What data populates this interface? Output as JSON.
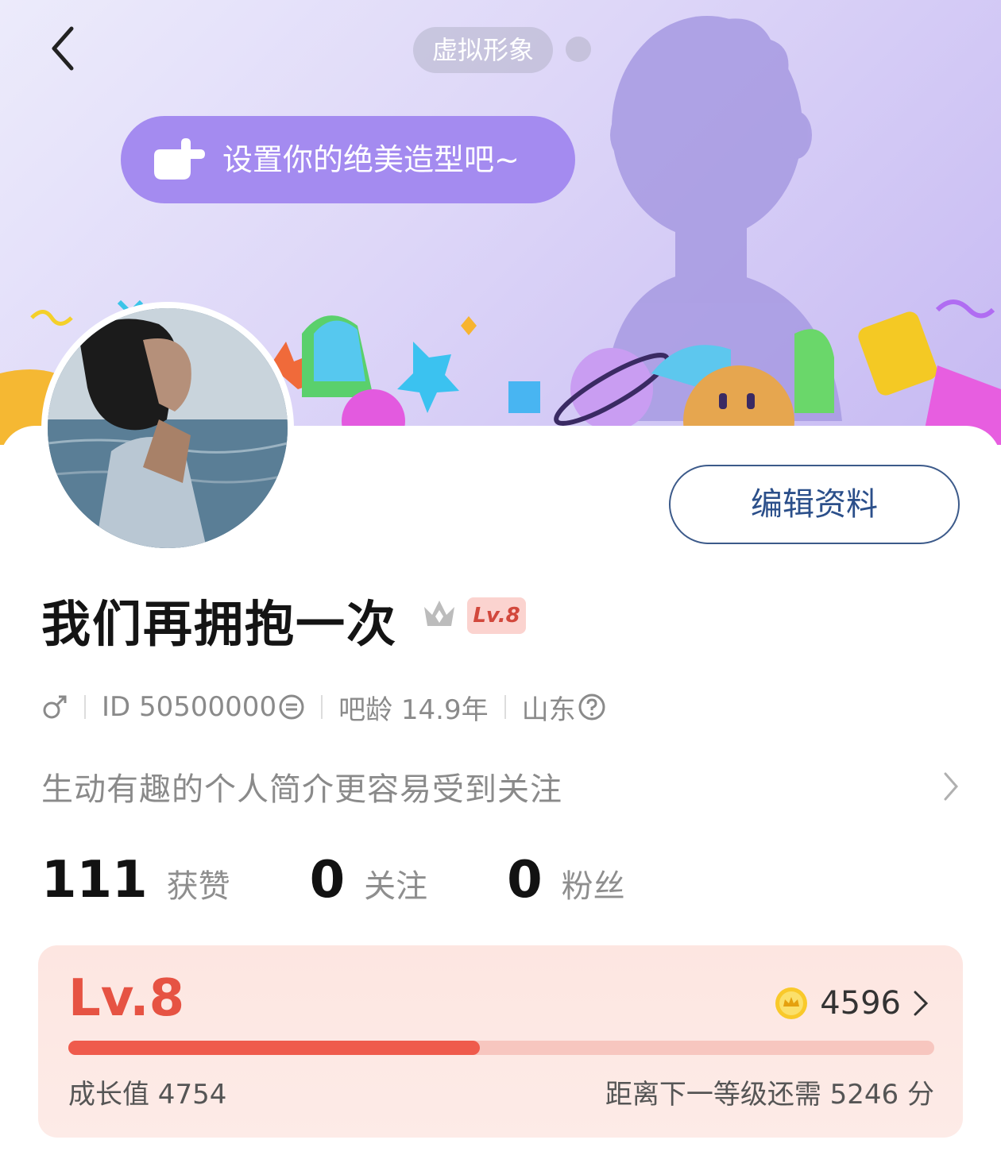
{
  "header": {
    "virtual_avatar_label": "虚拟形象",
    "setup_prompt": "设置你的绝美造型吧~"
  },
  "profile": {
    "edit_button": "编辑资料",
    "username": "我们再拥抱一次",
    "level_badge": "Lv.8",
    "gender_icon": "male-icon",
    "id_text": "ID 50500000",
    "age_text": "吧龄 14.9年",
    "region_text": "山东",
    "bio_placeholder": "生动有趣的个人简介更容易受到关注"
  },
  "stats": [
    {
      "value": "111",
      "label": "获赞"
    },
    {
      "value": "0",
      "label": "关注"
    },
    {
      "value": "0",
      "label": "粉丝"
    }
  ],
  "level_card": {
    "level": "Lv.8",
    "coins": "4596",
    "progress_fraction": 0.4754,
    "growth_text": "成长值 4754",
    "next_level_text": "距离下一等级还需 5246 分"
  },
  "colors": {
    "accent_red": "#ef5b4c",
    "banner_purple": "#a48bf0",
    "edit_blue": "#2b4f8a"
  }
}
